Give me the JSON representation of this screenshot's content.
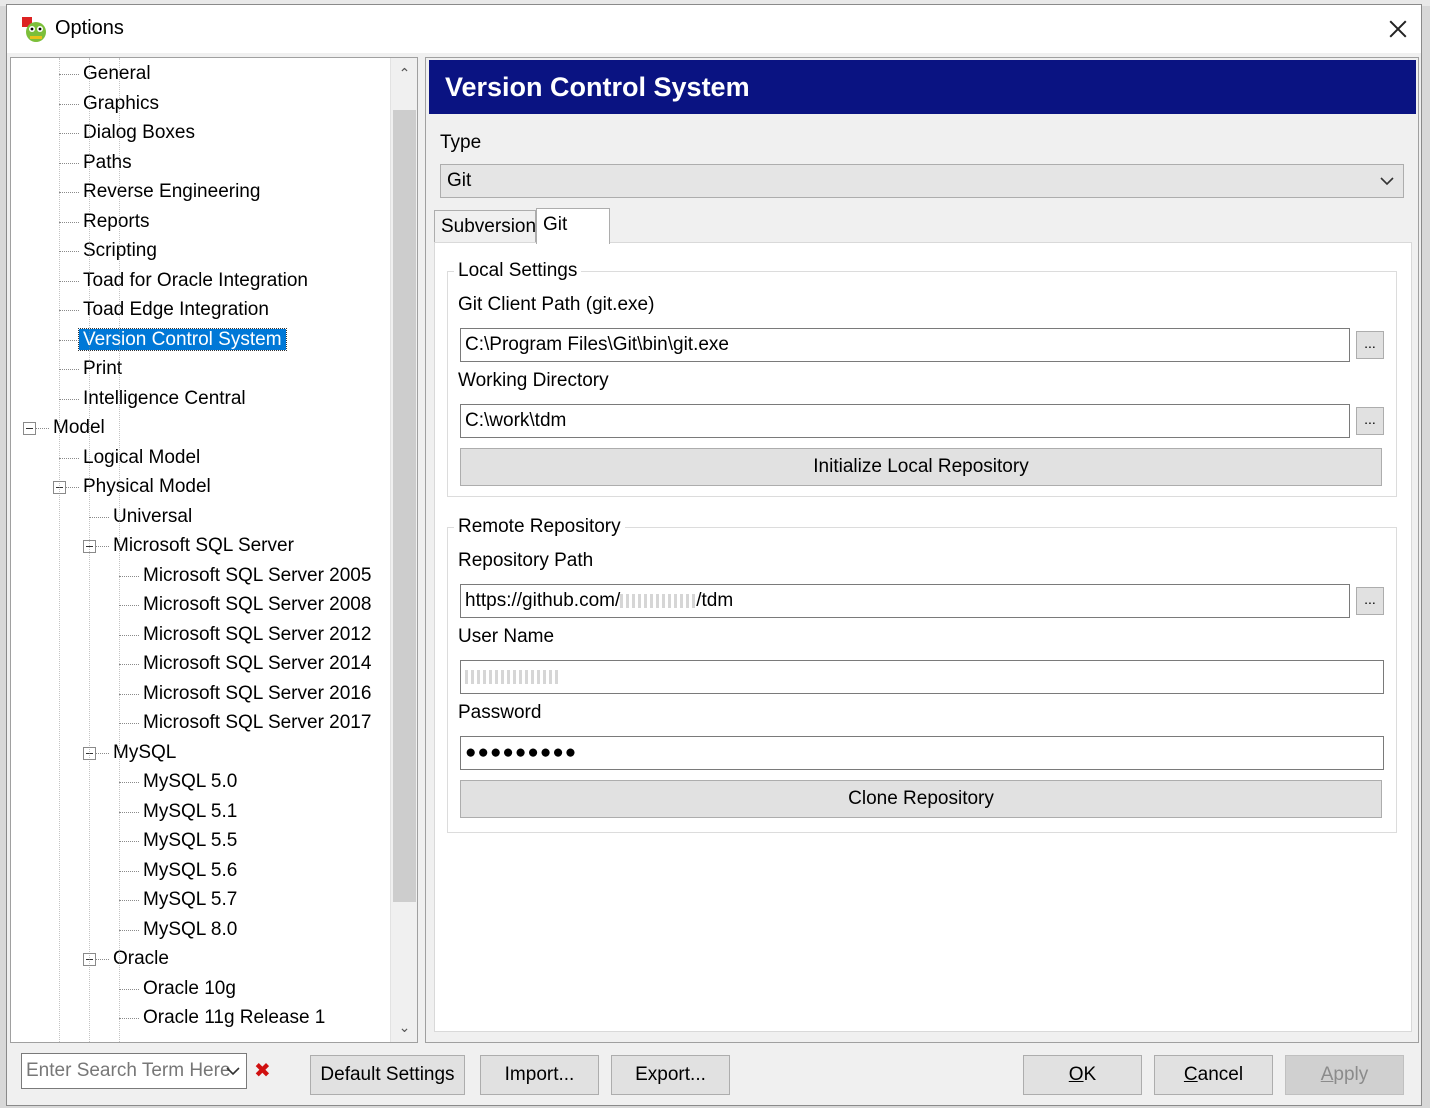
{
  "window": {
    "title": "Options",
    "close_label": "×"
  },
  "tree": {
    "items": [
      {
        "label": "General",
        "level": 2,
        "selected": false
      },
      {
        "label": "Graphics",
        "level": 2,
        "selected": false
      },
      {
        "label": "Dialog Boxes",
        "level": 2,
        "selected": false
      },
      {
        "label": "Paths",
        "level": 2,
        "selected": false
      },
      {
        "label": "Reverse Engineering",
        "level": 2,
        "selected": false
      },
      {
        "label": "Reports",
        "level": 2,
        "selected": false
      },
      {
        "label": "Scripting",
        "level": 2,
        "selected": false
      },
      {
        "label": "Toad for Oracle Integration",
        "level": 2,
        "selected": false
      },
      {
        "label": "Toad Edge Integration",
        "level": 2,
        "selected": false
      },
      {
        "label": "Version Control System",
        "level": 2,
        "selected": true
      },
      {
        "label": "Print",
        "level": 2,
        "selected": false
      },
      {
        "label": "Intelligence Central",
        "level": 2,
        "selected": false
      },
      {
        "label": "Model",
        "level": 1,
        "selected": false,
        "expanded": true
      },
      {
        "label": "Logical Model",
        "level": 2,
        "selected": false
      },
      {
        "label": "Physical Model",
        "level": 2,
        "selected": false,
        "expanded": true
      },
      {
        "label": "Universal",
        "level": 3,
        "selected": false
      },
      {
        "label": "Microsoft SQL Server",
        "level": 3,
        "selected": false,
        "expanded": true
      },
      {
        "label": "Microsoft SQL Server 2005",
        "level": 4,
        "selected": false
      },
      {
        "label": "Microsoft SQL Server 2008",
        "level": 4,
        "selected": false
      },
      {
        "label": "Microsoft SQL Server 2012",
        "level": 4,
        "selected": false
      },
      {
        "label": "Microsoft SQL Server 2014",
        "level": 4,
        "selected": false
      },
      {
        "label": "Microsoft SQL Server 2016",
        "level": 4,
        "selected": false
      },
      {
        "label": "Microsoft SQL Server 2017",
        "level": 4,
        "selected": false
      },
      {
        "label": "MySQL",
        "level": 3,
        "selected": false,
        "expanded": true
      },
      {
        "label": "MySQL 5.0",
        "level": 4,
        "selected": false
      },
      {
        "label": "MySQL 5.1",
        "level": 4,
        "selected": false
      },
      {
        "label": "MySQL 5.5",
        "level": 4,
        "selected": false
      },
      {
        "label": "MySQL 5.6",
        "level": 4,
        "selected": false
      },
      {
        "label": "MySQL 5.7",
        "level": 4,
        "selected": false
      },
      {
        "label": "MySQL 8.0",
        "level": 4,
        "selected": false
      },
      {
        "label": "Oracle",
        "level": 3,
        "selected": false,
        "expanded": true
      },
      {
        "label": "Oracle 10g",
        "level": 4,
        "selected": false
      },
      {
        "label": "Oracle 11g Release 1",
        "level": 4,
        "selected": false
      }
    ],
    "scroll_up": "^",
    "scroll_down": "v"
  },
  "panel": {
    "header": "Version Control System",
    "type_label": "Type",
    "type_value": "Git",
    "tabs": [
      "Subversion",
      "Git"
    ],
    "active_tab": "Git",
    "local": {
      "group_title": "Local Settings",
      "client_path_label": "Git Client Path (git.exe)",
      "client_path_value": "C:\\Program Files\\Git\\bin\\git.exe",
      "working_dir_label": "Working Directory",
      "working_dir_value": "C:\\work\\tdm",
      "browse_label": "...",
      "init_button": "Initialize Local Repository"
    },
    "remote": {
      "group_title": "Remote Repository",
      "repo_path_label": "Repository Path",
      "repo_path_prefix": "https://github.com/",
      "repo_path_suffix": "/tdm",
      "user_name_label": "User Name",
      "password_label": "Password",
      "password_value": "●●●●●●●●●",
      "clone_button": "Clone Repository"
    }
  },
  "bottom": {
    "search_placeholder": "Enter Search Term Here",
    "clear_icon": "✖",
    "default_settings": "Default Settings",
    "import": "Import...",
    "export": "Export...",
    "ok_mnemonic": "O",
    "ok_rest": "K",
    "cancel_mnemonic": "C",
    "cancel_rest": "ancel",
    "apply_mnemonic": "A",
    "apply_rest": "pply"
  },
  "colors": {
    "header_bg": "#0a1382",
    "selection": "#0078d7",
    "clear_icon": "#d01010"
  }
}
